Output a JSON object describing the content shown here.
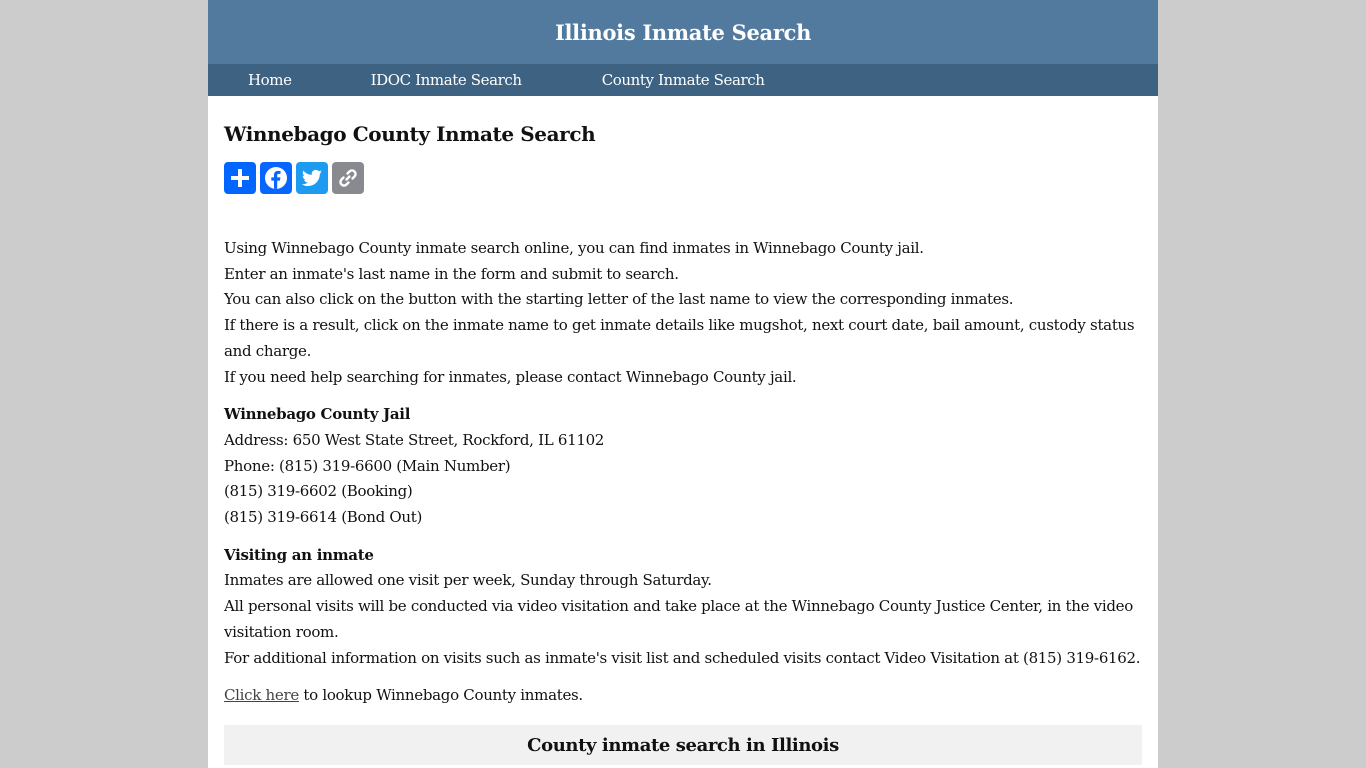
{
  "header": {
    "site_title": "Illinois Inmate Search"
  },
  "nav": {
    "items": [
      {
        "label": "Home"
      },
      {
        "label": "IDOC Inmate Search"
      },
      {
        "label": "County Inmate Search"
      }
    ]
  },
  "main": {
    "title": "Winnebago County Inmate Search",
    "share_buttons": [
      {
        "icon": "plus-icon",
        "label": "Share",
        "color": "#0166ff"
      },
      {
        "icon": "facebook-icon",
        "label": "Facebook",
        "color": "#0866ff"
      },
      {
        "icon": "twitter-icon",
        "label": "Twitter",
        "color": "#1d9bf0"
      },
      {
        "icon": "link-icon",
        "label": "Copy Link",
        "color": "#888a8f"
      }
    ],
    "intro_lines": [
      "Using Winnebago County inmate search online, you can find inmates in Winnebago County jail.",
      "Enter an inmate's last name in the form and submit to search.",
      "You can also click on the button with the starting letter of the last name to view the corresponding inmates.",
      "If there is a result, click on the inmate name to get inmate details like mugshot, next court date, bail amount, custody status and charge.",
      "If you need help searching for inmates, please contact Winnebago County jail."
    ],
    "jail": {
      "heading": "Winnebago County Jail",
      "lines": [
        "Address: 650 West State Street, Rockford, IL 61102",
        "Phone: (815) 319-6600 (Main Number)",
        "(815) 319-6602 (Booking)",
        "(815) 319-6614 (Bond Out)"
      ]
    },
    "visiting": {
      "heading": "Visiting an inmate",
      "lines": [
        "Inmates are allowed one visit per week, Sunday through Saturday.",
        "All personal visits will be conducted via video visitation and take place at the Winnebago County Justice Center, in the video visitation room.",
        "For additional information on visits such as inmate's visit list and scheduled visits contact Video Visitation at (815) 319-6162."
      ]
    },
    "lookup": {
      "link_text": "Click here",
      "rest_text": " to lookup Winnebago County inmates."
    },
    "county_section": {
      "heading": "County inmate search in Illinois"
    }
  },
  "colors": {
    "header_bg": "#527a9e",
    "nav_bg": "#3d6282",
    "page_bg": "#cccccc"
  }
}
